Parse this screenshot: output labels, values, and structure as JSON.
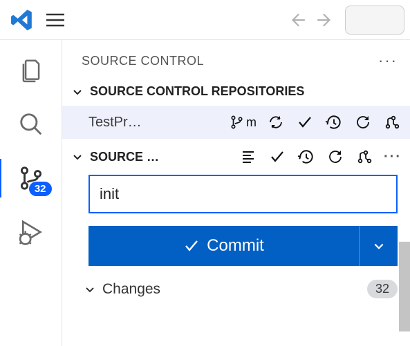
{
  "titlebar": {},
  "activity": {
    "scm_badge": "32"
  },
  "panel": {
    "title": "SOURCE CONTROL",
    "repos_section": "SOURCE CONTROL REPOSITORIES",
    "repo_name": "TestPr…",
    "branch_label": "m",
    "source_section": "SOURCE …",
    "commit_message_value": "init",
    "commit_button": "Commit",
    "changes_label": "Changes",
    "changes_count": "32"
  }
}
